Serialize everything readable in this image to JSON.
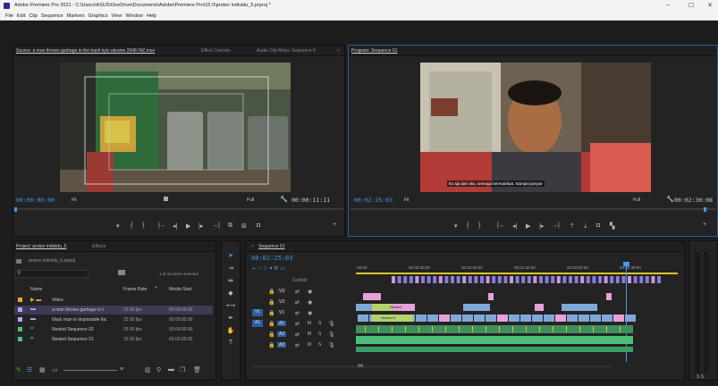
{
  "window": {
    "title": "Adobe Premiere Pro 2021 - C:\\Users\\ASUS\\OneDrive\\Documents\\Adobe\\Premiere Pro\\15.0\\proker individu_5.prproj *",
    "minimize": "–",
    "maximize": "☐",
    "close": "✕"
  },
  "menu": [
    "File",
    "Edit",
    "Clip",
    "Sequence",
    "Markers",
    "Graphics",
    "View",
    "Window",
    "Help"
  ],
  "source_panel": {
    "tabs": [
      "Source: a man throws garbage in the trash kyiv ukraine 2048 INZ.mov",
      "Effect Controls",
      "Audio Clip Mixer: Sequence 0",
      "»"
    ],
    "timecode": "00:00:00:00",
    "fit": "Fit",
    "full": "Full",
    "duration": "00:00:11:11"
  },
  "program_panel": {
    "tab": "Program: Sequence 01",
    "timecode": "00:02:25:03",
    "fit": "Fit",
    "full": "Full",
    "duration": "00:02:30:08",
    "subtitle": "Itu aja dari aku, semoga bermanfaat. Sampai jumpa!"
  },
  "project_panel": {
    "tabs": [
      "Project: proker individu_5",
      "Effects"
    ],
    "project_file": "proker individu_5.prproj",
    "items_selected": "1 of 10 items selected",
    "columns": [
      "Name",
      "Frame Rate",
      "Media Start"
    ],
    "rows": [
      {
        "name": "Video",
        "rate": "",
        "start": "",
        "color": "#e8a341",
        "type": "bin"
      },
      {
        "name": "a man throws garbage in t",
        "rate": "25.00 fps",
        "start": "00:00:00:00",
        "color": "#b6a7e8",
        "type": "clip"
      },
      {
        "name": "black man in disposable fac",
        "rate": "25.00 fps",
        "start": "00:00:00:00",
        "color": "#b6a7e8",
        "type": "clip"
      },
      {
        "name": "Nested Sequence 02",
        "rate": "25.00 fps",
        "start": "00:00:00:00",
        "color": "#4cc27a",
        "type": "seq"
      },
      {
        "name": "Nested Sequence 01",
        "rate": "25.00 fps",
        "start": "00:00:00:00",
        "color": "#4cc27a",
        "type": "seq"
      }
    ]
  },
  "timeline": {
    "tab": "Sequence 01",
    "timecode": "00:02:25:03",
    "subtitle_track": "Subtitle",
    "ruler": [
      ":00:00",
      "00:00:30:00",
      "00:01:00:00",
      "00:01:30:00",
      "00:02:00:00",
      "00:02:30:00"
    ],
    "tracks": [
      "V3",
      "V2",
      "V1",
      "A1",
      "A2",
      "A3"
    ],
    "track_letters": [
      "M",
      "S"
    ],
    "clip_labels": [
      "Nested",
      "Nested S"
    ]
  },
  "colors": {
    "accent": "#3f9ae8",
    "video_clip": "#7fa8d8",
    "audio_clip": "#4bbf7a",
    "pink_clip": "#e8a0d8",
    "nested_clip": "#b5d36a",
    "purple_subtitle": "#8a7cd8"
  }
}
